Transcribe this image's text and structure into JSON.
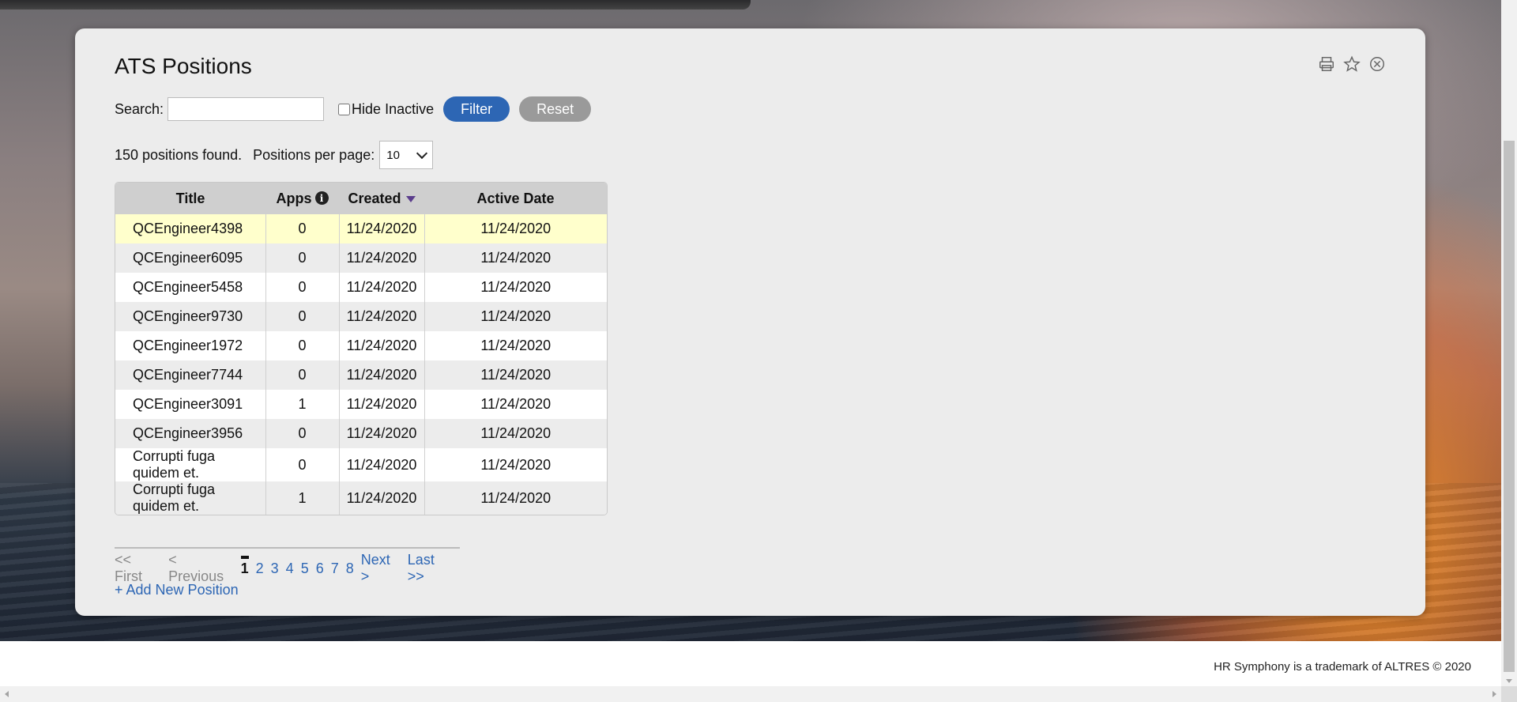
{
  "page": {
    "title": "ATS Positions",
    "footer": "HR Symphony is a trademark of ALTRES © 2020"
  },
  "window_icons": [
    "printer-icon",
    "star-icon",
    "close-circle-icon"
  ],
  "search": {
    "label": "Search:",
    "value": "",
    "placeholder": "",
    "hide_inactive_label": "Hide Inactive",
    "hide_inactive_checked": false,
    "filter_label": "Filter",
    "reset_label": "Reset"
  },
  "summary": {
    "count_text": "150 positions found.",
    "per_page_label": "Positions per page:",
    "per_page_value": "10"
  },
  "table": {
    "columns": [
      "Title",
      "Apps",
      "Created",
      "Active Date"
    ],
    "sorted_column": "Created",
    "rows": [
      {
        "title": "QCEngineer4398",
        "apps": "0",
        "created": "11/24/2020",
        "active": "11/24/2020"
      },
      {
        "title": "QCEngineer6095",
        "apps": "0",
        "created": "11/24/2020",
        "active": "11/24/2020"
      },
      {
        "title": "QCEngineer5458",
        "apps": "0",
        "created": "11/24/2020",
        "active": "11/24/2020"
      },
      {
        "title": "QCEngineer9730",
        "apps": "0",
        "created": "11/24/2020",
        "active": "11/24/2020"
      },
      {
        "title": "QCEngineer1972",
        "apps": "0",
        "created": "11/24/2020",
        "active": "11/24/2020"
      },
      {
        "title": "QCEngineer7744",
        "apps": "0",
        "created": "11/24/2020",
        "active": "11/24/2020"
      },
      {
        "title": "QCEngineer3091",
        "apps": "1",
        "created": "11/24/2020",
        "active": "11/24/2020"
      },
      {
        "title": "QCEngineer3956",
        "apps": "0",
        "created": "11/24/2020",
        "active": "11/24/2020"
      },
      {
        "title": "Corrupti fuga quidem et.",
        "apps": "0",
        "created": "11/24/2020",
        "active": "11/24/2020"
      },
      {
        "title": "Corrupti fuga quidem et.",
        "apps": "1",
        "created": "11/24/2020",
        "active": "11/24/2020"
      }
    ]
  },
  "pager": {
    "first": "<< First",
    "previous": "< Previous",
    "current": "1",
    "pages": [
      "2",
      "3",
      "4",
      "5",
      "6",
      "7",
      "8"
    ],
    "next": "Next >",
    "last": "Last >>"
  },
  "add_new": "+ Add New Position"
}
